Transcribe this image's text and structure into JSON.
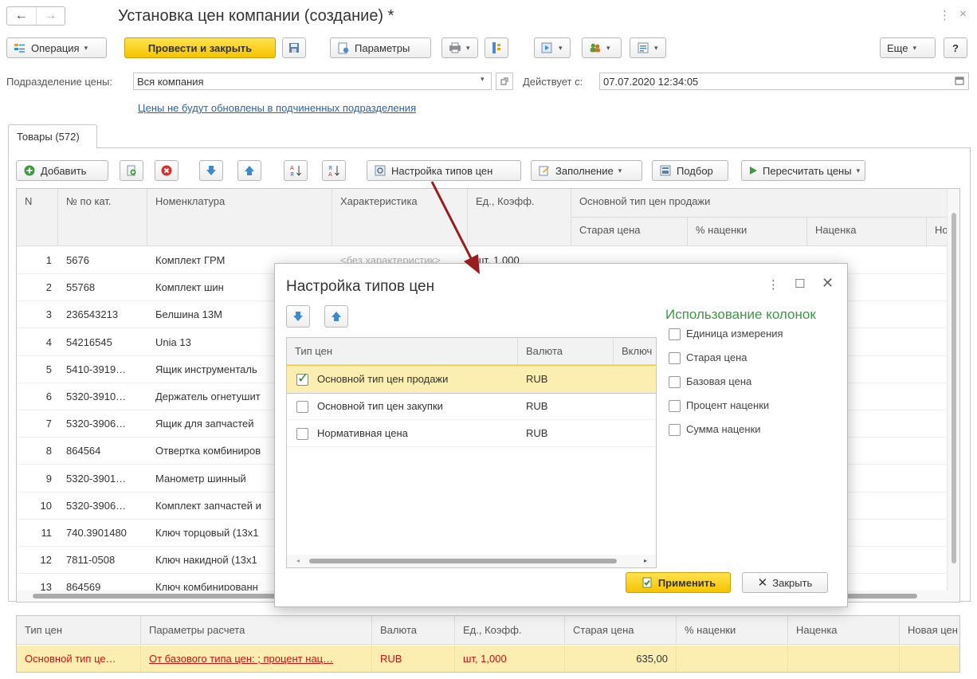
{
  "window": {
    "title": "Установка цен компании (создание) *",
    "back": "←",
    "forward": "→",
    "menu": "⋮",
    "close": "×"
  },
  "toolbar": {
    "operation": "Операция",
    "post_close": "Провести и закрыть",
    "params": "Параметры",
    "more": "Еще",
    "help": "?"
  },
  "form": {
    "division_label": "Подразделение цены:",
    "division_value": "Вся компания",
    "valid_from_label": "Действует с:",
    "valid_from_value": "07.07.2020 12:34:05",
    "note_link": "Цены не будут обновлены в подчиненных подразделения"
  },
  "tab": {
    "label": "Товары (572)"
  },
  "items_toolbar": {
    "add": "Добавить",
    "price_types_setup": "Настройка типов цен",
    "fill": "Заполнение",
    "pick": "Подбор",
    "recalc": "Пересчитать цены"
  },
  "main_table": {
    "headers": {
      "n": "N",
      "catno": "№ по кат.",
      "nomenclature": "Номенклатура",
      "characteristic": "Характеристика",
      "unit": "Ед., Коэфф.",
      "group": "Основной тип цен продажи",
      "old_price": "Старая цена",
      "markup_pct": "% наценки",
      "markup": "Наценка",
      "new": "Но"
    },
    "first_row_characteristic": "<без характеристик>",
    "first_row_unit": "шт, 1,000",
    "rows": [
      {
        "n": "1",
        "cat": "5676",
        "name": "Комплект ГРМ"
      },
      {
        "n": "2",
        "cat": "55768",
        "name": "Комплект шин"
      },
      {
        "n": "3",
        "cat": "236543213",
        "name": "Белшина 13М"
      },
      {
        "n": "4",
        "cat": "54216545",
        "name": "Unia 13"
      },
      {
        "n": "5",
        "cat": "5410-3919…",
        "name": "Ящик инструменталь"
      },
      {
        "n": "6",
        "cat": "5320-3910…",
        "name": "Держатель огнетушит"
      },
      {
        "n": "7",
        "cat": "5320-3906…",
        "name": "Ящик для запчастей"
      },
      {
        "n": "8",
        "cat": "864564",
        "name": "Отвертка комбиниров"
      },
      {
        "n": "9",
        "cat": "5320-3901…",
        "name": "Манометр шинный"
      },
      {
        "n": "10",
        "cat": "5320-3906…",
        "name": "Комплект запчастей и"
      },
      {
        "n": "11",
        "cat": "740.3901480",
        "name": "Ключ торцовый (13x1"
      },
      {
        "n": "12",
        "cat": "7811-0508",
        "name": "Ключ накидной (13x1"
      },
      {
        "n": "13",
        "cat": "864569",
        "name": "Ключ комбинированн"
      }
    ]
  },
  "bottom_table": {
    "headers": [
      "Тип цен",
      "Параметры расчета",
      "Валюта",
      "Ед., Коэфф.",
      "Старая цена",
      "% наценки",
      "Наценка",
      "Новая цен"
    ],
    "row": {
      "price_type": "Основной тип це…",
      "calc_params": "От базового типа цен: ; процент нац…",
      "currency": "RUB",
      "unit": "шт, 1,000",
      "old_price": "635,00"
    }
  },
  "modal": {
    "title": "Настройка типов цен",
    "menu": "⋮",
    "maximize": "☐",
    "close": "✕",
    "table_headers": {
      "type": "Тип цен",
      "currency": "Валюта",
      "include": "Включ"
    },
    "price_types": [
      {
        "name": "Основной тип цен продажи",
        "currency": "RUB",
        "checked": true
      },
      {
        "name": "Основной тип цен закупки",
        "currency": "RUB",
        "checked": false
      },
      {
        "name": "Нормативная цена",
        "currency": "RUB",
        "checked": false
      }
    ],
    "columns_title": "Использование колонок",
    "column_options": [
      "Единица измерения",
      "Старая цена",
      "Базовая цена",
      "Процент наценки",
      "Сумма наценки"
    ],
    "apply": "Применить",
    "close_btn": "Закрыть"
  },
  "colors": {
    "accent_yellow": "#f5c400",
    "selected_row": "#fbeeb0",
    "link_blue": "#2c62a6",
    "green_title": "#3a9a45",
    "red_text": "#cc1111",
    "arrow_red": "#9b1c1c"
  }
}
